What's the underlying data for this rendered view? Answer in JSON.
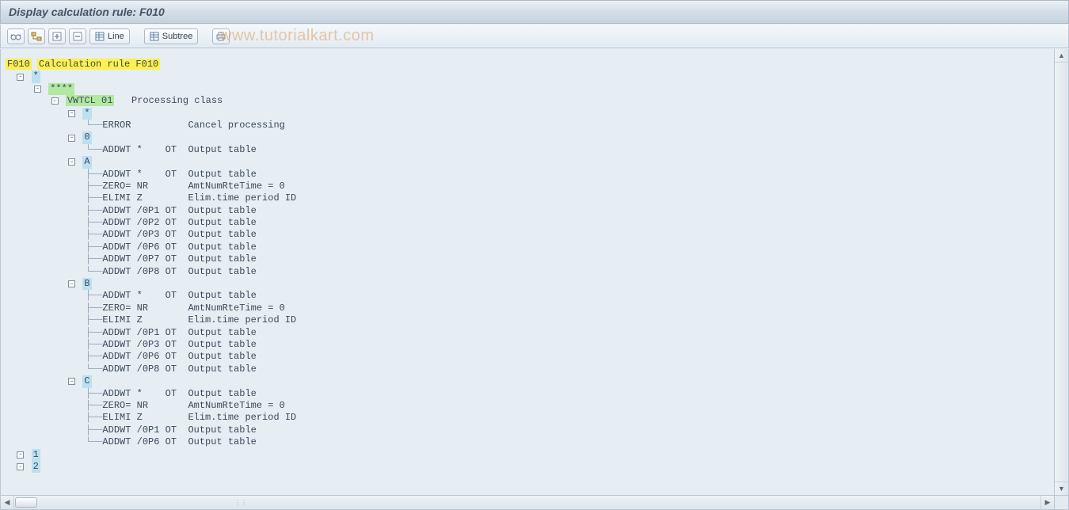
{
  "titlebar": {
    "text": "Display calculation rule: F010"
  },
  "toolbar": {
    "line_label": "Line",
    "subtree_label": "Subtree"
  },
  "watermark": "www.tutorialkart.com",
  "tree": {
    "root": {
      "code": "F010",
      "desc": "Calculation rule F010"
    },
    "l1": {
      "label": "*"
    },
    "l2": {
      "label": "****"
    },
    "l3": {
      "code": "VWTCL 01",
      "desc": "Processing class"
    },
    "grp_star": {
      "label": "*",
      "rows": [
        {
          "op": "ERROR",
          "p1": "",
          "p2": "",
          "desc": "Cancel processing"
        }
      ]
    },
    "grp_0": {
      "label": "0",
      "rows": [
        {
          "op": "ADDWT",
          "p1": "*",
          "p2": "OT",
          "desc": "Output table"
        }
      ]
    },
    "grp_A": {
      "label": "A",
      "rows": [
        {
          "op": "ADDWT",
          "p1": "*",
          "p2": "OT",
          "desc": "Output table"
        },
        {
          "op": "ZERO=",
          "p1": "NR",
          "p2": "",
          "desc": "AmtNumRteTime = 0"
        },
        {
          "op": "ELIMI",
          "p1": "Z",
          "p2": "",
          "desc": "Elim.time period ID"
        },
        {
          "op": "ADDWT",
          "p1": "/0P1",
          "p2": "OT",
          "desc": "Output table"
        },
        {
          "op": "ADDWT",
          "p1": "/0P2",
          "p2": "OT",
          "desc": "Output table"
        },
        {
          "op": "ADDWT",
          "p1": "/0P3",
          "p2": "OT",
          "desc": "Output table"
        },
        {
          "op": "ADDWT",
          "p1": "/0P6",
          "p2": "OT",
          "desc": "Output table"
        },
        {
          "op": "ADDWT",
          "p1": "/0P7",
          "p2": "OT",
          "desc": "Output table"
        },
        {
          "op": "ADDWT",
          "p1": "/0P8",
          "p2": "OT",
          "desc": "Output table"
        }
      ]
    },
    "grp_B": {
      "label": "B",
      "rows": [
        {
          "op": "ADDWT",
          "p1": "*",
          "p2": "OT",
          "desc": "Output table"
        },
        {
          "op": "ZERO=",
          "p1": "NR",
          "p2": "",
          "desc": "AmtNumRteTime = 0"
        },
        {
          "op": "ELIMI",
          "p1": "Z",
          "p2": "",
          "desc": "Elim.time period ID"
        },
        {
          "op": "ADDWT",
          "p1": "/0P1",
          "p2": "OT",
          "desc": "Output table"
        },
        {
          "op": "ADDWT",
          "p1": "/0P3",
          "p2": "OT",
          "desc": "Output table"
        },
        {
          "op": "ADDWT",
          "p1": "/0P6",
          "p2": "OT",
          "desc": "Output table"
        },
        {
          "op": "ADDWT",
          "p1": "/0P8",
          "p2": "OT",
          "desc": "Output table"
        }
      ]
    },
    "grp_C": {
      "label": "C",
      "rows": [
        {
          "op": "ADDWT",
          "p1": "*",
          "p2": "OT",
          "desc": "Output table"
        },
        {
          "op": "ZERO=",
          "p1": "NR",
          "p2": "",
          "desc": "AmtNumRteTime = 0"
        },
        {
          "op": "ELIMI",
          "p1": "Z",
          "p2": "",
          "desc": "Elim.time period ID"
        },
        {
          "op": "ADDWT",
          "p1": "/0P1",
          "p2": "OT",
          "desc": "Output table"
        },
        {
          "op": "ADDWT",
          "p1": "/0P6",
          "p2": "OT",
          "desc": "Output table"
        }
      ]
    },
    "grp_1": {
      "label": "1"
    },
    "grp_2": {
      "label": "2"
    }
  }
}
